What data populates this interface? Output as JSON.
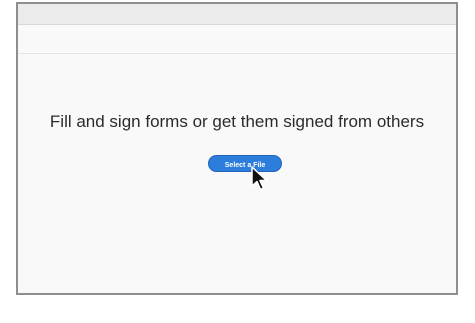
{
  "main": {
    "headline": "Fill and sign forms or get them signed from others",
    "select_file_label": "Select a File"
  },
  "colors": {
    "accent": "#2d7ddc"
  },
  "icons": {
    "pointer": "mouse-pointer-icon"
  }
}
